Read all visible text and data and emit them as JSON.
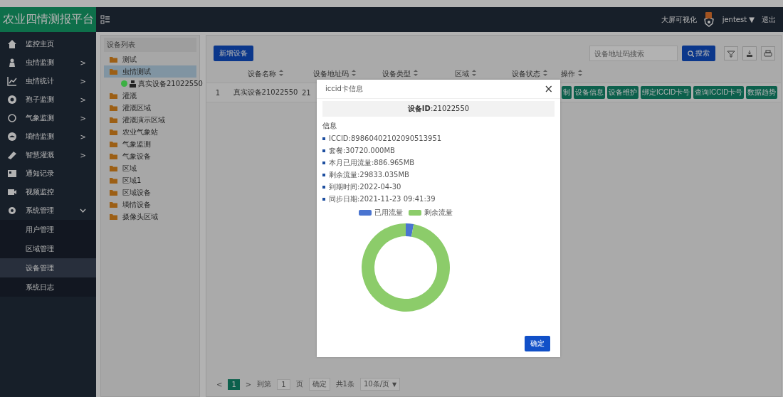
{
  "header": {
    "logo": "农业四情测报平台",
    "big_screen": "大屏可视化",
    "user": "jentest ▼",
    "logout": "退出"
  },
  "sidebar": {
    "items": [
      {
        "label": "监控主页"
      },
      {
        "label": "虫情监测",
        "arrow": ">"
      },
      {
        "label": "虫情统计",
        "arrow": ">"
      },
      {
        "label": "孢子监测",
        "arrow": ">"
      },
      {
        "label": "气象监测",
        "arrow": ">"
      },
      {
        "label": "墒情监测",
        "arrow": ">"
      },
      {
        "label": "智慧灌溉",
        "arrow": ">"
      },
      {
        "label": "通知记录"
      },
      {
        "label": "视频监控"
      },
      {
        "label": "系统管理",
        "expanded": true,
        "children": [
          {
            "label": "用户管理",
            "selected": false
          },
          {
            "label": "区域管理",
            "selected": false
          },
          {
            "label": "设备管理",
            "selected": true
          },
          {
            "label": "系统日志",
            "selected": false
          }
        ]
      }
    ]
  },
  "tree": {
    "title": "设备列表",
    "items": [
      {
        "label": "测试",
        "selected": false
      },
      {
        "label": "虫情测试",
        "selected": true,
        "children": [
          {
            "label": "真实设备21022550",
            "color": "#3cb043"
          }
        ]
      },
      {
        "label": "灌溉",
        "selected": false
      },
      {
        "label": "灌溉区域",
        "selected": false
      },
      {
        "label": "灌溉演示区域",
        "selected": false
      },
      {
        "label": "农业气象站",
        "selected": false
      },
      {
        "label": "气象监测",
        "selected": false
      },
      {
        "label": "气象设备",
        "selected": false
      },
      {
        "label": "区域",
        "selected": false
      },
      {
        "label": "区域1",
        "selected": false
      },
      {
        "label": "区域设备",
        "selected": false
      },
      {
        "label": "墒情设备",
        "selected": false
      },
      {
        "label": "摄像头区域",
        "selected": false
      }
    ]
  },
  "toolbar": {
    "add_button": "新增设备",
    "search_placeholder": "设备地址码搜索",
    "search_button": "搜索"
  },
  "table": {
    "columns": [
      "设备名称",
      "设备地址码",
      "设备类型",
      "区域",
      "设备状态",
      "操作"
    ],
    "rows": [
      {
        "index": "1",
        "name": "真实设备21022550",
        "address": "21",
        "actions": [
          "制",
          "设备信息",
          "设备维护",
          "绑定ICCID卡号",
          "查询ICCID卡号",
          "数据趋势"
        ]
      }
    ]
  },
  "pagination": {
    "prev": "<",
    "page": "1",
    "next": ">",
    "goto": "到第",
    "page_input": "1",
    "page_unit": "页",
    "confirm": "确定",
    "total": "共1条",
    "page_size": "10条/页",
    "page_size_arrow": "▼"
  },
  "modal": {
    "title": "iccid卡信息",
    "close": "×",
    "device_id": "**设备ID**:21022550",
    "section": "信息",
    "info": [
      "ICCID:89860402102090513951",
      "套餐:30720.000MB",
      "本月已用流量:886.965MB",
      "剩余流量:29833.035MB",
      "到期时间:2022-04-30",
      "同步日期:2021-11-23 09:41:39"
    ],
    "chart_data": {
      "type": "donut",
      "categories": [
        "已用流量",
        "剩余流量"
      ],
      "values": [
        2.89,
        97.11
      ],
      "colors": [
        "#4a74d0",
        "#8ccc6a"
      ],
      "legend": true
    },
    "ok_button": "确定"
  }
}
